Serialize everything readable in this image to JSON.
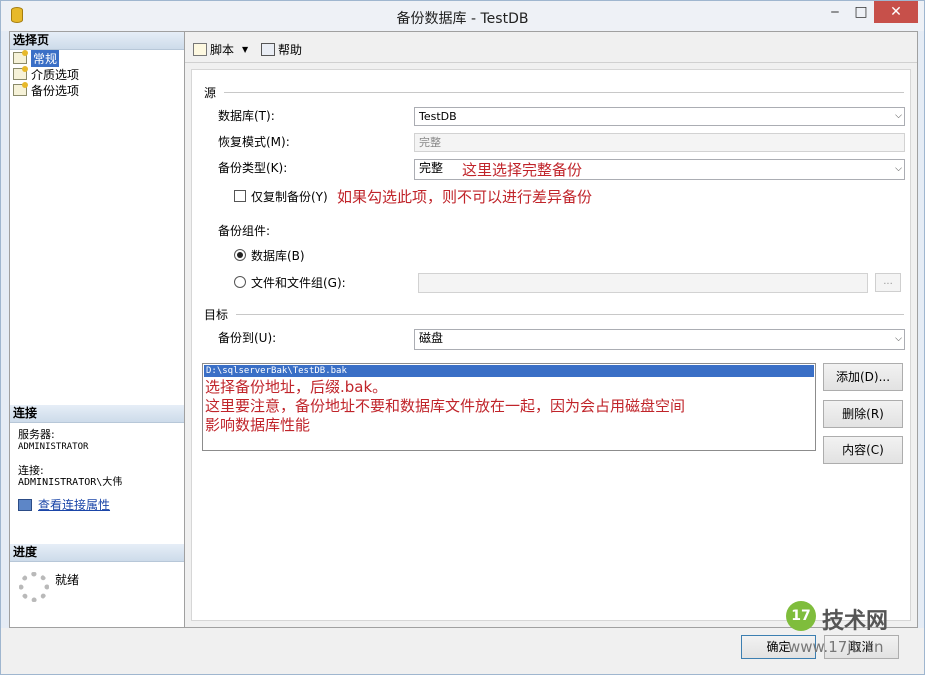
{
  "window": {
    "title": "备份数据库 - TestDB",
    "min": "‒",
    "max": "□",
    "close": "✕"
  },
  "left": {
    "select_page_header": "选择页",
    "pages": [
      {
        "label": "常规",
        "selected": true
      },
      {
        "label": "介质选项",
        "selected": false
      },
      {
        "label": "备份选项",
        "selected": false
      }
    ],
    "connection_header": "连接",
    "server_label": "服务器:",
    "server_value": "ADMINISTRATOR",
    "connection_label": "连接:",
    "connection_value": "ADMINISTRATOR\\大伟",
    "view_props_link": "查看连接属性",
    "progress_header": "进度",
    "progress_status": "就绪"
  },
  "toolbar": {
    "script_label": "脚本",
    "help_label": "帮助"
  },
  "form": {
    "source_section": "源",
    "database_label": "数据库(T):",
    "database_value": "TestDB",
    "recovery_label": "恢复模式(M):",
    "recovery_value": "完整",
    "backup_type_label": "备份类型(K):",
    "backup_type_value": "完整",
    "copy_only_label": "仅复制备份(Y)",
    "copy_only_checked": false,
    "component_label": "备份组件:",
    "comp_database_label": "数据库(B)",
    "comp_files_label": "文件和文件组(G):",
    "files_ellipsis": "...",
    "target_section": "目标",
    "backup_to_label": "备份到(U):",
    "backup_to_value": "磁盘",
    "destinations": [
      "D:\\sqlserverBak\\TestDB.bak"
    ],
    "add_button": "添加(D)...",
    "remove_button": "删除(R)",
    "content_button": "内容(C)"
  },
  "annotations": {
    "backup_type_note": "这里选择完整备份",
    "copy_only_note": "如果勾选此项，则不可以进行差异备份",
    "dest_note_1": "选择备份地址，后缀.bak。",
    "dest_note_2": "这里要注意，备份地址不要和数据库文件放在一起，因为会占用磁盘空间",
    "dest_note_3": "影响数据库性能"
  },
  "footer": {
    "ok_button": "确定",
    "cancel_button": "取消"
  },
  "watermark": {
    "logo": "17",
    "name": "技术网",
    "url": "www.17jb.cn"
  }
}
